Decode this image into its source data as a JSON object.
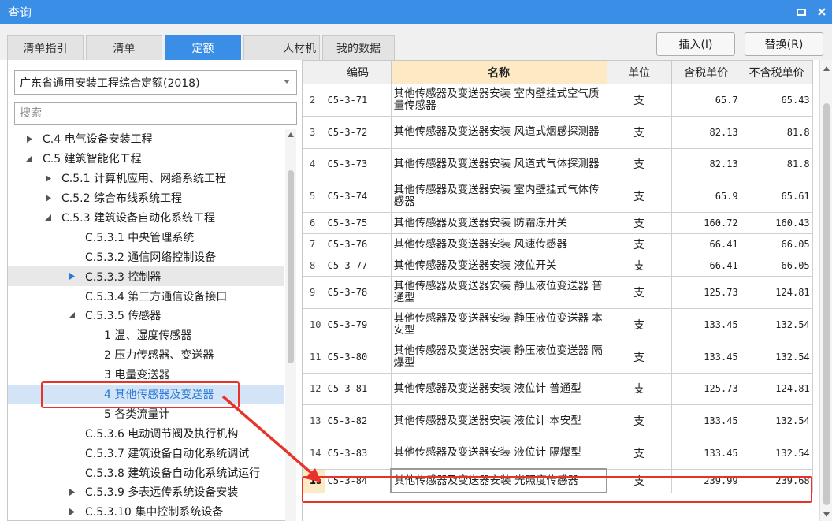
{
  "window": {
    "title": "查询"
  },
  "tabs": [
    {
      "label": "清单指引"
    },
    {
      "label": "清单"
    },
    {
      "label": "定额"
    },
    {
      "label": "人材机"
    },
    {
      "label": "我的数据"
    }
  ],
  "actions": {
    "insert_label": "插入(I)",
    "replace_label": "替换(R)"
  },
  "left": {
    "quota_library": "广东省通用安装工程综合定额(2018)",
    "search_placeholder": "搜索",
    "tree": [
      {
        "label": "C.4 电气设备安装工程",
        "toggle": "collapsed"
      },
      {
        "label": "C.5 建筑智能化工程",
        "toggle": "expanded"
      },
      {
        "label": "C.5.1 计算机应用、网络系统工程",
        "toggle": "collapsed"
      },
      {
        "label": "C.5.2 综合布线系统工程",
        "toggle": "collapsed"
      },
      {
        "label": "C.5.3 建筑设备自动化系统工程",
        "toggle": "expanded"
      },
      {
        "label": "C.5.3.1 中央管理系统",
        "toggle": "none"
      },
      {
        "label": "C.5.3.2 通信网络控制设备",
        "toggle": "none"
      },
      {
        "label": "C.5.3.3 控制器",
        "toggle": "collapsed-blue"
      },
      {
        "label": "C.5.3.4 第三方通信设备接口",
        "toggle": "none"
      },
      {
        "label": "C.5.3.5 传感器",
        "toggle": "expanded"
      },
      {
        "label": "1 温、湿度传感器",
        "toggle": "none"
      },
      {
        "label": "2 压力传感器、变送器",
        "toggle": "none"
      },
      {
        "label": "3 电量变送器",
        "toggle": "none"
      },
      {
        "label": "4 其他传感器及变送器",
        "toggle": "none"
      },
      {
        "label": "5 各类流量计",
        "toggle": "none"
      },
      {
        "label": "C.5.3.6 电动调节阀及执行机构",
        "toggle": "none"
      },
      {
        "label": "C.5.3.7 建筑设备自动化系统调试",
        "toggle": "none"
      },
      {
        "label": "C.5.3.8 建筑设备自动化系统试运行",
        "toggle": "none"
      },
      {
        "label": "C.5.3.9 多表远传系统设备安装",
        "toggle": "collapsed"
      },
      {
        "label": "C.5.3.10 集中控制系统设备",
        "toggle": "collapsed"
      }
    ]
  },
  "grid": {
    "columns": [
      "编码",
      "名称",
      "单位",
      "含税单价",
      "不含税单价"
    ],
    "rows": [
      {
        "no": "2",
        "code": "C5-3-71",
        "name": "其他传感器及变送器安装 室内壁挂式空气质量传感器",
        "unit": "支",
        "price_tax": "65.7",
        "price_notax": "65.43"
      },
      {
        "no": "3",
        "code": "C5-3-72",
        "name": "其他传感器及变送器安装 风道式烟感探测器",
        "unit": "支",
        "price_tax": "82.13",
        "price_notax": "81.8"
      },
      {
        "no": "4",
        "code": "C5-3-73",
        "name": "其他传感器及变送器安装 风道式气体探测器",
        "unit": "支",
        "price_tax": "82.13",
        "price_notax": "81.8"
      },
      {
        "no": "5",
        "code": "C5-3-74",
        "name": "其他传感器及变送器安装 室内壁挂式气体传感器",
        "unit": "支",
        "price_tax": "65.9",
        "price_notax": "65.61"
      },
      {
        "no": "6",
        "code": "C5-3-75",
        "name": "其他传感器及变送器安装 防霜冻开关",
        "unit": "支",
        "price_tax": "160.72",
        "price_notax": "160.43"
      },
      {
        "no": "7",
        "code": "C5-3-76",
        "name": "其他传感器及变送器安装 风速传感器",
        "unit": "支",
        "price_tax": "66.41",
        "price_notax": "66.05"
      },
      {
        "no": "8",
        "code": "C5-3-77",
        "name": "其他传感器及变送器安装 液位开关",
        "unit": "支",
        "price_tax": "66.41",
        "price_notax": "66.05"
      },
      {
        "no": "9",
        "code": "C5-3-78",
        "name": "其他传感器及变送器安装 静压液位变送器 普通型",
        "unit": "支",
        "price_tax": "125.73",
        "price_notax": "124.81"
      },
      {
        "no": "10",
        "code": "C5-3-79",
        "name": "其他传感器及变送器安装 静压液位变送器 本安型",
        "unit": "支",
        "price_tax": "133.45",
        "price_notax": "132.54"
      },
      {
        "no": "11",
        "code": "C5-3-80",
        "name": "其他传感器及变送器安装 静压液位变送器 隔爆型",
        "unit": "支",
        "price_tax": "133.45",
        "price_notax": "132.54"
      },
      {
        "no": "12",
        "code": "C5-3-81",
        "name": "其他传感器及变送器安装 液位计 普通型",
        "unit": "支",
        "price_tax": "125.73",
        "price_notax": "124.81"
      },
      {
        "no": "13",
        "code": "C5-3-82",
        "name": "其他传感器及变送器安装 液位计 本安型",
        "unit": "支",
        "price_tax": "133.45",
        "price_notax": "132.54"
      },
      {
        "no": "14",
        "code": "C5-3-83",
        "name": "其他传感器及变送器安装 液位计 隔爆型",
        "unit": "支",
        "price_tax": "133.45",
        "price_notax": "132.54"
      },
      {
        "no": "15",
        "code": "C5-3-84",
        "name": "其他传感器及变送器安装 光照度传感器",
        "unit": "支",
        "price_tax": "239.99",
        "price_notax": "239.68"
      }
    ]
  },
  "colors": {
    "accent": "#3a8ee6",
    "annotation": "#e8322a",
    "header_highlight": "#fde9c4"
  },
  "icons": [
    "minimize-icon",
    "close-icon",
    "dropdown-caret-icon",
    "expand-arrow-icon",
    "collapse-arrow-icon",
    "scroll-up-icon",
    "scroll-down-icon"
  ]
}
